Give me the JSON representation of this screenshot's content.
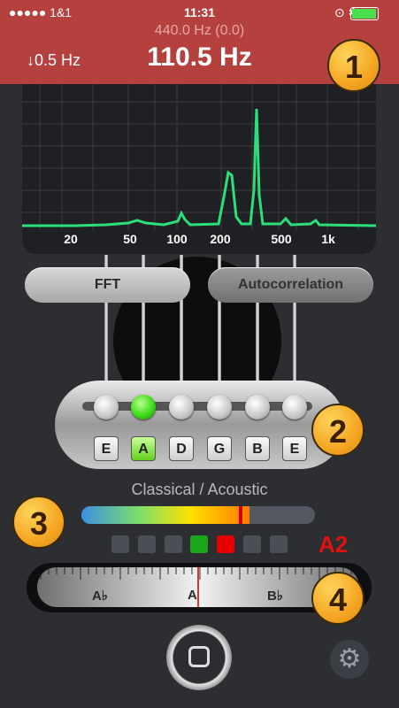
{
  "status_bar": {
    "signal": "●●●●● 1&1",
    "time": "11:31",
    "icons": "⊙ ✱"
  },
  "header": {
    "reference": "440.0 Hz (0.0)",
    "frequency": "110.5 Hz",
    "delta": "↓0.5 Hz"
  },
  "badges": [
    "1",
    "2",
    "3",
    "4"
  ],
  "spectrum": {
    "x_ticks": [
      "20",
      "50",
      "100",
      "200",
      "500",
      "1k"
    ]
  },
  "modes": {
    "fft": "FFT",
    "autocorrelation": "Autocorrelation",
    "selected": "FFT"
  },
  "strings": {
    "notes": [
      "E",
      "A",
      "D",
      "G",
      "B",
      "E"
    ],
    "active_index": 1
  },
  "instrument": "Classical / Acoustic",
  "level": {
    "fill_fraction": 0.72
  },
  "tuning_indicator": {
    "lit": [
      3,
      4
    ],
    "colors": [
      "#1aa51a",
      "#e80000"
    ]
  },
  "note": "A2",
  "ruler": {
    "labels": [
      "A♭",
      "A",
      "B♭"
    ]
  },
  "icons": {
    "settings": "gear-icon",
    "home": "stop-icon"
  },
  "colors": {
    "header": "#b5413f",
    "spectrum_line": "#2be07a",
    "accent": "#f5a623"
  }
}
